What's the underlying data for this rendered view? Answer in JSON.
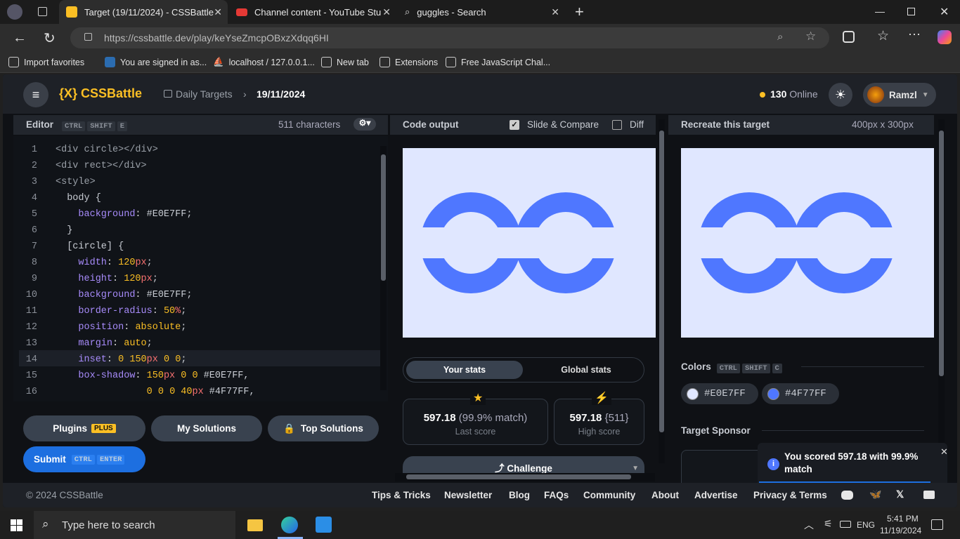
{
  "browser": {
    "tabs": [
      {
        "label": "Target (19/11/2024) - CSSBattle",
        "active": true
      },
      {
        "label": "Channel content - YouTube Studio",
        "active": false
      },
      {
        "label": "guggles - Search",
        "active": false
      }
    ],
    "new_tab": "+",
    "url": "https://cssbattle.dev/play/keYseZmcpOBxzXdqq6HI",
    "bookmarks": [
      "Import favorites",
      "You are signed in as...",
      "localhost / 127.0.0.1...",
      "New tab",
      "Extensions",
      "Free JavaScript Chal..."
    ]
  },
  "app": {
    "logo": "{X} CSSBattle",
    "breadcrumb": {
      "section": "Daily Targets",
      "date": "19/11/2024"
    },
    "online_count": "130",
    "online_label": "Online",
    "user": "Ramzl",
    "editor": {
      "title": "Editor",
      "shortcut": [
        "CTRL",
        "SHIFT",
        "E"
      ],
      "char_count": "511 characters",
      "lines": [
        "<div circle></div>",
        "<div rect></div>",
        "<style>",
        "  body {",
        "    background: #E0E7FF;",
        "  }",
        "  [circle] {",
        "    width: 120px;",
        "    height: 120px;",
        "    background: #E0E7FF;",
        "    border-radius: 50%;",
        "    position: absolute;",
        "    margin: auto;",
        "    inset: 0 150px 0 0;",
        "    box-shadow: 150px 0 0 #E0E7FF,",
        "                0 0 0 40px #4F77FF,"
      ],
      "highlight_line": 14
    },
    "buttons": {
      "plugins": "Plugins",
      "plus": "PLUS",
      "my_solutions": "My Solutions",
      "top_solutions": "Top Solutions",
      "submit": "Submit",
      "submit_keys": [
        "CTRL",
        "ENTER"
      ]
    },
    "output": {
      "title": "Code output",
      "slide_compare": "Slide & Compare",
      "slide_compare_checked": true,
      "diff": "Diff",
      "diff_checked": false
    },
    "stats": {
      "tabs": [
        "Your stats",
        "Global stats"
      ],
      "last_score": "597.18",
      "last_match": "(99.9% match)",
      "last_label": "Last score",
      "high_score": "597.18",
      "high_chars": "{511}",
      "high_label": "High score",
      "challenge": "Challenge"
    },
    "target": {
      "title": "Recreate this target",
      "size": "400px x 300px",
      "colors_label": "Colors",
      "colors_shortcut": [
        "CTRL",
        "SHIFT",
        "C"
      ],
      "colors": [
        "#E0E7FF",
        "#4F77FF"
      ],
      "sponsor_label": "Target Sponsor"
    },
    "toast": "You scored 597.18 with 99.9% match",
    "footer": {
      "copyright": "© 2024 CSSBattle",
      "links": [
        "Tips & Tricks",
        "Newsletter",
        "Blog",
        "FAQs",
        "Community",
        "About",
        "Advertise",
        "Privacy & Terms"
      ]
    }
  },
  "taskbar": {
    "search": "Type here to search",
    "lang": "ENG",
    "time": "5:41 PM",
    "date": "11/19/2024"
  },
  "colors": {
    "accent": "#4F77FF",
    "bg": "#E0E7FF",
    "yellow": "#fbbf24"
  }
}
